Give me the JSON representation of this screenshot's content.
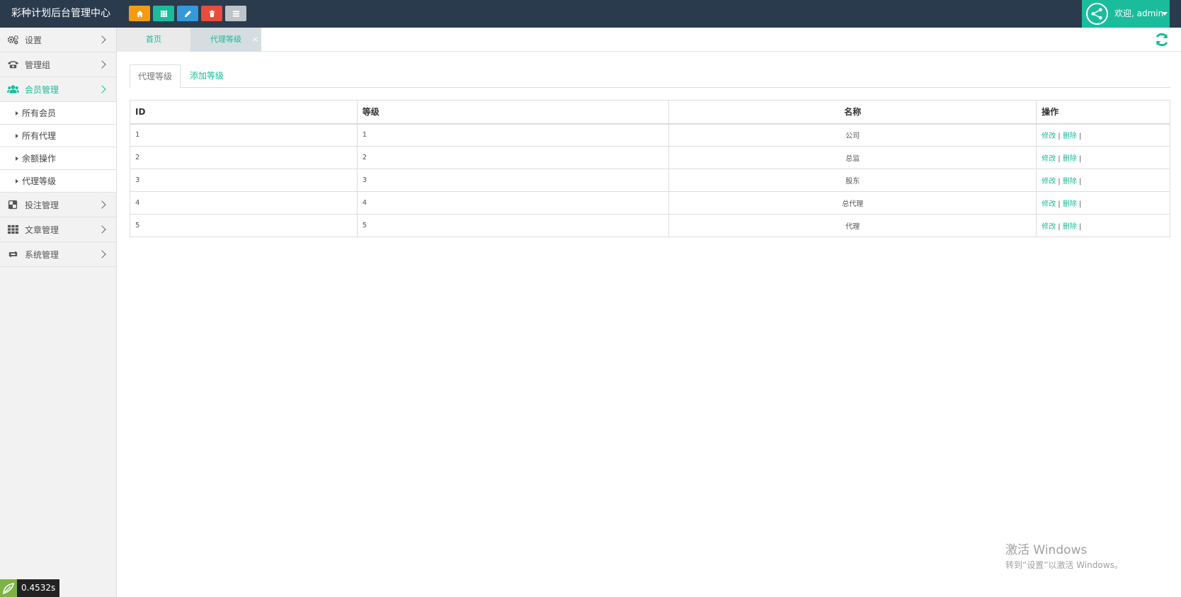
{
  "app": {
    "title": "彩种计划后台管理中心"
  },
  "toolbar": {
    "buttons": [
      {
        "icon": "home-icon",
        "color": "#f39c12"
      },
      {
        "icon": "grid-icon",
        "color": "#1abc9c"
      },
      {
        "icon": "pencil-icon",
        "color": "#3498db"
      },
      {
        "icon": "trash-icon",
        "color": "#e74c3c"
      },
      {
        "icon": "list-icon",
        "color": "#bdc3c7"
      }
    ]
  },
  "user": {
    "greeting": "欢迎, admin",
    "accent": "#1abc9c"
  },
  "sidebar": {
    "items": [
      {
        "label": "设置",
        "icon": "gears-icon"
      },
      {
        "label": "管理组",
        "icon": "phone-icon"
      },
      {
        "label": "会员管理",
        "icon": "users-icon",
        "active": true,
        "children": [
          {
            "label": "所有会员"
          },
          {
            "label": "所有代理"
          },
          {
            "label": "余额操作"
          },
          {
            "label": "代理等级"
          }
        ]
      },
      {
        "label": "投注管理",
        "icon": "checker-icon"
      },
      {
        "label": "文章管理",
        "icon": "apps-icon"
      },
      {
        "label": "系统管理",
        "icon": "retweet-icon"
      }
    ]
  },
  "tabs": [
    {
      "label": "首页"
    },
    {
      "label": "代理等级",
      "close": "×"
    }
  ],
  "subtabs": [
    {
      "label": "代理等级"
    },
    {
      "label": "添加等级"
    }
  ],
  "table": {
    "headers": [
      "ID",
      "等级",
      "名称",
      "操作"
    ],
    "rows": [
      {
        "id": "1",
        "level": "1",
        "name": "公司"
      },
      {
        "id": "2",
        "level": "2",
        "name": "总监"
      },
      {
        "id": "3",
        "level": "3",
        "name": "股东"
      },
      {
        "id": "4",
        "level": "4",
        "name": "总代理"
      },
      {
        "id": "5",
        "level": "5",
        "name": "代理"
      }
    ],
    "actions": {
      "edit": "修改",
      "delete": "删除",
      "separator": "|"
    }
  },
  "timer": {
    "value": "0.4532s"
  },
  "watermark": {
    "line1": "激活 Windows",
    "line2": "转到“设置”以激活 Windows。"
  }
}
